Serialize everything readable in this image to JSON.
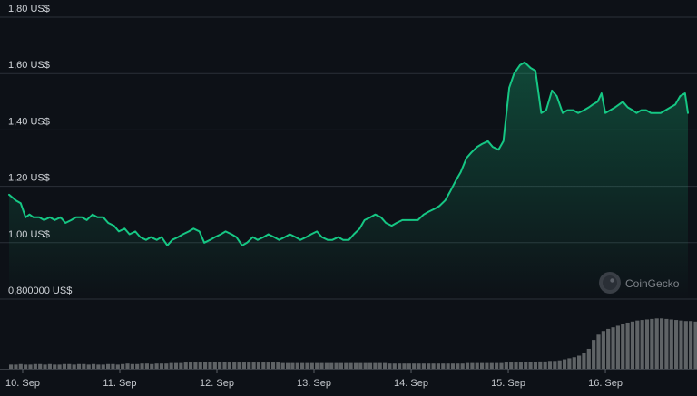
{
  "watermark": {
    "text": "CoinGecko"
  },
  "colors": {
    "background": "#0d1117",
    "price_line": "#16c784",
    "grid": "#2b3139",
    "volume_bar": "#5f6366",
    "axis_text": "#d0d4d9"
  },
  "chart_data": {
    "type": "area",
    "y_axis_ticks": [
      "0,800000 US$",
      "1,00 US$",
      "1,20 US$",
      "1,40 US$",
      "1,60 US$",
      "1,80 US$"
    ],
    "y_tick_values": [
      0.8,
      1.0,
      1.2,
      1.4,
      1.6,
      1.8
    ],
    "ylim": [
      0.8,
      1.8
    ],
    "x_axis_ticks": [
      "10. Sep",
      "11. Sep",
      "12. Sep",
      "13. Sep",
      "14. Sep",
      "15. Sep",
      "16. Sep"
    ],
    "x_tick_values": [
      0,
      1,
      2,
      3,
      4,
      5,
      6
    ],
    "xlim": [
      -0.14,
      6.85
    ],
    "grid": true,
    "legend": "none",
    "series": [
      {
        "type": "line",
        "x": [
          -0.14,
          -0.07,
          -0.02,
          0.03,
          0.07,
          0.11,
          0.17,
          0.22,
          0.28,
          0.33,
          0.39,
          0.44,
          0.5,
          0.55,
          0.61,
          0.66,
          0.72,
          0.77,
          0.83,
          0.88,
          0.94,
          0.99,
          1.05,
          1.1,
          1.16,
          1.21,
          1.27,
          1.32,
          1.38,
          1.43,
          1.49,
          1.54,
          1.6,
          1.65,
          1.71,
          1.76,
          1.82,
          1.87,
          1.93,
          1.98,
          2.04,
          2.09,
          2.15,
          2.2,
          2.26,
          2.31,
          2.37,
          2.42,
          2.48,
          2.53,
          2.59,
          2.64,
          2.7,
          2.75,
          2.81,
          2.86,
          2.92,
          2.97,
          3.03,
          3.08,
          3.14,
          3.19,
          3.25,
          3.3,
          3.36,
          3.41,
          3.47,
          3.52,
          3.58,
          3.63,
          3.69,
          3.74,
          3.8,
          3.85,
          3.91,
          3.96,
          4.02,
          4.07,
          4.13,
          4.18,
          4.24,
          4.29,
          4.35,
          4.4,
          4.46,
          4.51,
          4.57,
          4.62,
          4.68,
          4.73,
          4.79,
          4.84,
          4.9,
          4.95,
          5.01,
          5.06,
          5.12,
          5.17,
          5.23,
          5.28,
          5.34,
          5.39,
          5.45,
          5.5,
          5.56,
          5.61,
          5.67,
          5.72,
          5.78,
          5.83,
          5.87,
          5.92,
          5.96,
          6.0,
          6.05,
          6.1,
          6.14,
          6.18,
          6.23,
          6.28,
          6.32,
          6.37,
          6.42,
          6.47,
          6.52,
          6.57,
          6.62,
          6.67,
          6.72,
          6.77,
          6.82,
          6.85
        ],
        "y": [
          1.17,
          1.15,
          1.14,
          1.09,
          1.1,
          1.09,
          1.09,
          1.08,
          1.09,
          1.08,
          1.09,
          1.07,
          1.08,
          1.09,
          1.09,
          1.08,
          1.1,
          1.09,
          1.09,
          1.07,
          1.06,
          1.04,
          1.05,
          1.03,
          1.04,
          1.02,
          1.01,
          1.02,
          1.01,
          1.02,
          0.99,
          1.01,
          1.02,
          1.03,
          1.04,
          1.05,
          1.04,
          1.0,
          1.01,
          1.02,
          1.03,
          1.04,
          1.03,
          1.02,
          0.99,
          1.0,
          1.02,
          1.01,
          1.02,
          1.03,
          1.02,
          1.01,
          1.02,
          1.03,
          1.02,
          1.01,
          1.02,
          1.03,
          1.04,
          1.02,
          1.01,
          1.01,
          1.02,
          1.01,
          1.01,
          1.03,
          1.05,
          1.08,
          1.09,
          1.1,
          1.09,
          1.07,
          1.06,
          1.07,
          1.08,
          1.08,
          1.08,
          1.08,
          1.1,
          1.11,
          1.12,
          1.13,
          1.15,
          1.18,
          1.22,
          1.25,
          1.3,
          1.32,
          1.34,
          1.35,
          1.36,
          1.34,
          1.33,
          1.36,
          1.55,
          1.6,
          1.63,
          1.64,
          1.62,
          1.61,
          1.46,
          1.47,
          1.54,
          1.52,
          1.46,
          1.47,
          1.47,
          1.46,
          1.47,
          1.48,
          1.49,
          1.5,
          1.53,
          1.46,
          1.47,
          1.48,
          1.49,
          1.5,
          1.48,
          1.47,
          1.46,
          1.47,
          1.47,
          1.46,
          1.46,
          1.46,
          1.47,
          1.48,
          1.49,
          1.52,
          1.53,
          1.46
        ]
      }
    ],
    "volume": {
      "type": "bar",
      "x_start": -0.14,
      "x_step": 0.05,
      "values": [
        0.08,
        0.08,
        0.09,
        0.08,
        0.08,
        0.09,
        0.09,
        0.08,
        0.09,
        0.08,
        0.08,
        0.09,
        0.09,
        0.08,
        0.09,
        0.09,
        0.08,
        0.09,
        0.08,
        0.08,
        0.09,
        0.09,
        0.08,
        0.09,
        0.1,
        0.09,
        0.09,
        0.1,
        0.1,
        0.09,
        0.1,
        0.1,
        0.1,
        0.11,
        0.11,
        0.11,
        0.12,
        0.12,
        0.12,
        0.12,
        0.13,
        0.13,
        0.13,
        0.13,
        0.13,
        0.12,
        0.12,
        0.12,
        0.12,
        0.12,
        0.12,
        0.12,
        0.12,
        0.12,
        0.12,
        0.12,
        0.11,
        0.11,
        0.11,
        0.11,
        0.11,
        0.11,
        0.11,
        0.11,
        0.11,
        0.11,
        0.11,
        0.11,
        0.11,
        0.11,
        0.11,
        0.11,
        0.11,
        0.11,
        0.11,
        0.11,
        0.11,
        0.11,
        0.1,
        0.1,
        0.1,
        0.1,
        0.1,
        0.1,
        0.1,
        0.1,
        0.1,
        0.1,
        0.1,
        0.1,
        0.1,
        0.1,
        0.1,
        0.1,
        0.11,
        0.11,
        0.11,
        0.11,
        0.11,
        0.11,
        0.11,
        0.11,
        0.12,
        0.12,
        0.12,
        0.12,
        0.13,
        0.13,
        0.13,
        0.14,
        0.14,
        0.15,
        0.15,
        0.16,
        0.18,
        0.2,
        0.22,
        0.25,
        0.3,
        0.38,
        0.55,
        0.65,
        0.72,
        0.76,
        0.79,
        0.82,
        0.85,
        0.88,
        0.9,
        0.92,
        0.93,
        0.94,
        0.95,
        0.96,
        0.96,
        0.95,
        0.94,
        0.93,
        0.92,
        0.91,
        0.91,
        0.9
      ]
    }
  }
}
